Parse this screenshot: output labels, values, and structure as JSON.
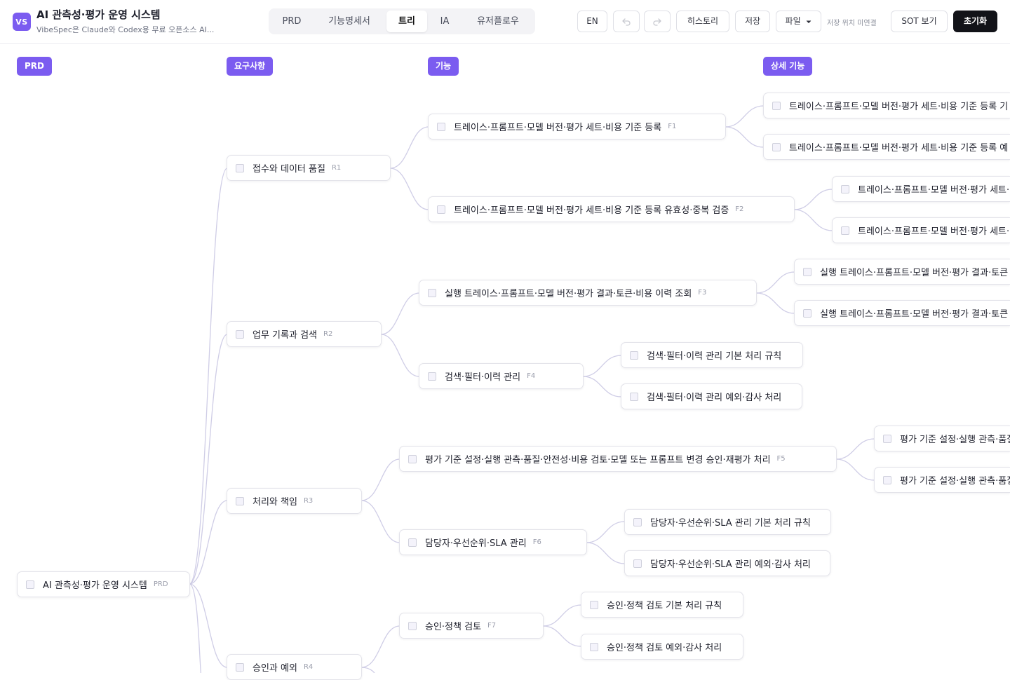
{
  "app": {
    "logo": "VS",
    "title": "AI 관측성·평가 운영 시스템",
    "subtitle": "VibeSpec은 Claude와 Codex용 무료 오픈소스 AI..."
  },
  "tabs": [
    {
      "label": "PRD",
      "active": false
    },
    {
      "label": "기능명세서",
      "active": false
    },
    {
      "label": "트리",
      "active": true
    },
    {
      "label": "IA",
      "active": false
    },
    {
      "label": "유저플로우",
      "active": false
    }
  ],
  "toolbar": {
    "lang": "EN",
    "undo_icon": "undo-icon",
    "redo_icon": "redo-icon",
    "history": "히스토리",
    "save": "저장",
    "file": "파일",
    "save_status": "저장 위치 미연결",
    "sot": "SOT 보기",
    "reset": "초기화"
  },
  "columns": [
    "PRD",
    "요구사항",
    "기능",
    "상세 기능"
  ],
  "tree": {
    "root": {
      "label": "AI 관측성·평가 운영 시스템",
      "code": "PRD"
    },
    "requirements": [
      {
        "label": "접수와 데이터 품질",
        "code": "R1"
      },
      {
        "label": "업무 기록과 검색",
        "code": "R2"
      },
      {
        "label": "처리와 책임",
        "code": "R3"
      },
      {
        "label": "승인과 예외",
        "code": "R4"
      }
    ],
    "features": [
      {
        "label": "트레이스·프롬프트·모델 버전·평가 세트·비용 기준 등록",
        "code": "F1"
      },
      {
        "label": "트레이스·프롬프트·모델 버전·평가 세트·비용 기준 등록 유효성·중복 검증",
        "code": "F2"
      },
      {
        "label": "실행 트레이스·프롬프트·모델 버전·평가 결과·토큰·비용 이력 조회",
        "code": "F3"
      },
      {
        "label": "검색·필터·이력 관리",
        "code": "F4"
      },
      {
        "label": "평가 기준 설정·실행 관측·품질·안전성·비용 검토·모델 또는 프롬프트 변경 승인·재평가 처리",
        "code": "F5"
      },
      {
        "label": "담당자·우선순위·SLA 관리",
        "code": "F6"
      },
      {
        "label": "승인·정책 검토",
        "code": "F7"
      }
    ],
    "details": [
      {
        "label": "트레이스·프롬프트·모델 버전·평가 세트·비용 기준 등록 기"
      },
      {
        "label": "트레이스·프롬프트·모델 버전·평가 세트·비용 기준 등록 예"
      },
      {
        "label": "트레이스·프롬프트·모델 버전·평가 세트·"
      },
      {
        "label": "트레이스·프롬프트·모델 버전·평가 세트·"
      },
      {
        "label": "실행 트레이스·프롬프트·모델 버전·평가 결과·토큰"
      },
      {
        "label": "실행 트레이스·프롬프트·모델 버전·평가 결과·토큰"
      },
      {
        "label": "검색·필터·이력 관리 기본 처리 규칙"
      },
      {
        "label": "검색·필터·이력 관리 예외·감사 처리"
      },
      {
        "label": "평가 기준 설정·실행 관측·품질"
      },
      {
        "label": "평가 기준 설정·실행 관측·품질"
      },
      {
        "label": "담당자·우선순위·SLA 관리 기본 처리 규칙"
      },
      {
        "label": "담당자·우선순위·SLA 관리 예외·감사 처리"
      },
      {
        "label": "승인·정책 검토 기본 처리 규칙"
      },
      {
        "label": "승인·정책 검토 예외·감사 처리"
      }
    ]
  },
  "colors": {
    "accent": "#7b5cf0",
    "connector": "#cfcde6",
    "node_border": "#e3e3ea"
  }
}
